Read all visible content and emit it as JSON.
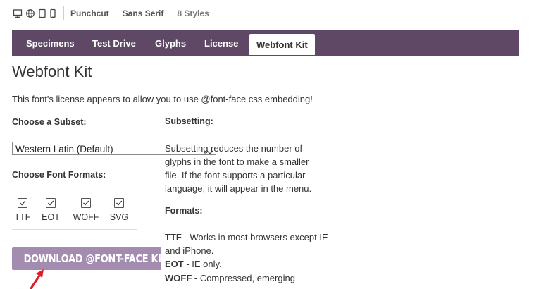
{
  "topbar": {
    "icons": [
      "desktop-icon",
      "globe-icon",
      "tablet-icon",
      "phone-icon"
    ],
    "font_name": "Punchcut",
    "category": "Sans Serif",
    "styles": "8 Styles"
  },
  "tabs": [
    {
      "label": "Specimens",
      "active": false
    },
    {
      "label": "Test Drive",
      "active": false
    },
    {
      "label": "Glyphs",
      "active": false
    },
    {
      "label": "License",
      "active": false
    },
    {
      "label": "Webfont Kit",
      "active": true
    }
  ],
  "main": {
    "title": "Webfont Kit",
    "intro": "This font's license appears to allow you to use @font-face css embedding!",
    "subset_label": "Choose a Subset:",
    "subset_value": "Western Latin (Default)",
    "formats_label": "Choose Font Formats:",
    "formats": [
      {
        "label": "TTF",
        "checked": true
      },
      {
        "label": "EOT",
        "checked": true
      },
      {
        "label": "WOFF",
        "checked": true
      },
      {
        "label": "SVG",
        "checked": true
      }
    ],
    "download_label": "DOWNLOAD @FONT-FACE KIT"
  },
  "help": {
    "subsetting_heading": "Subsetting:",
    "subsetting_lines": [
      "Subsetting reduces the number of",
      "glyphs in the font to make a smaller",
      "file. If the font supports a particular",
      "language, it will appear in the menu."
    ],
    "formats_heading": "Formats:",
    "ttf_name": "TTF",
    "ttf_desc_1": " - Works in most browsers except IE",
    "ttf_desc_2": "and iPhone.",
    "eot_name": "EOT",
    "eot_desc": " - IE only.",
    "woff_name": "WOFF",
    "woff_desc": " - Compressed, emerging"
  },
  "colors": {
    "tab_bar": "#5f4766",
    "download_button": "#a48cb0",
    "arrow": "#e0192b"
  }
}
